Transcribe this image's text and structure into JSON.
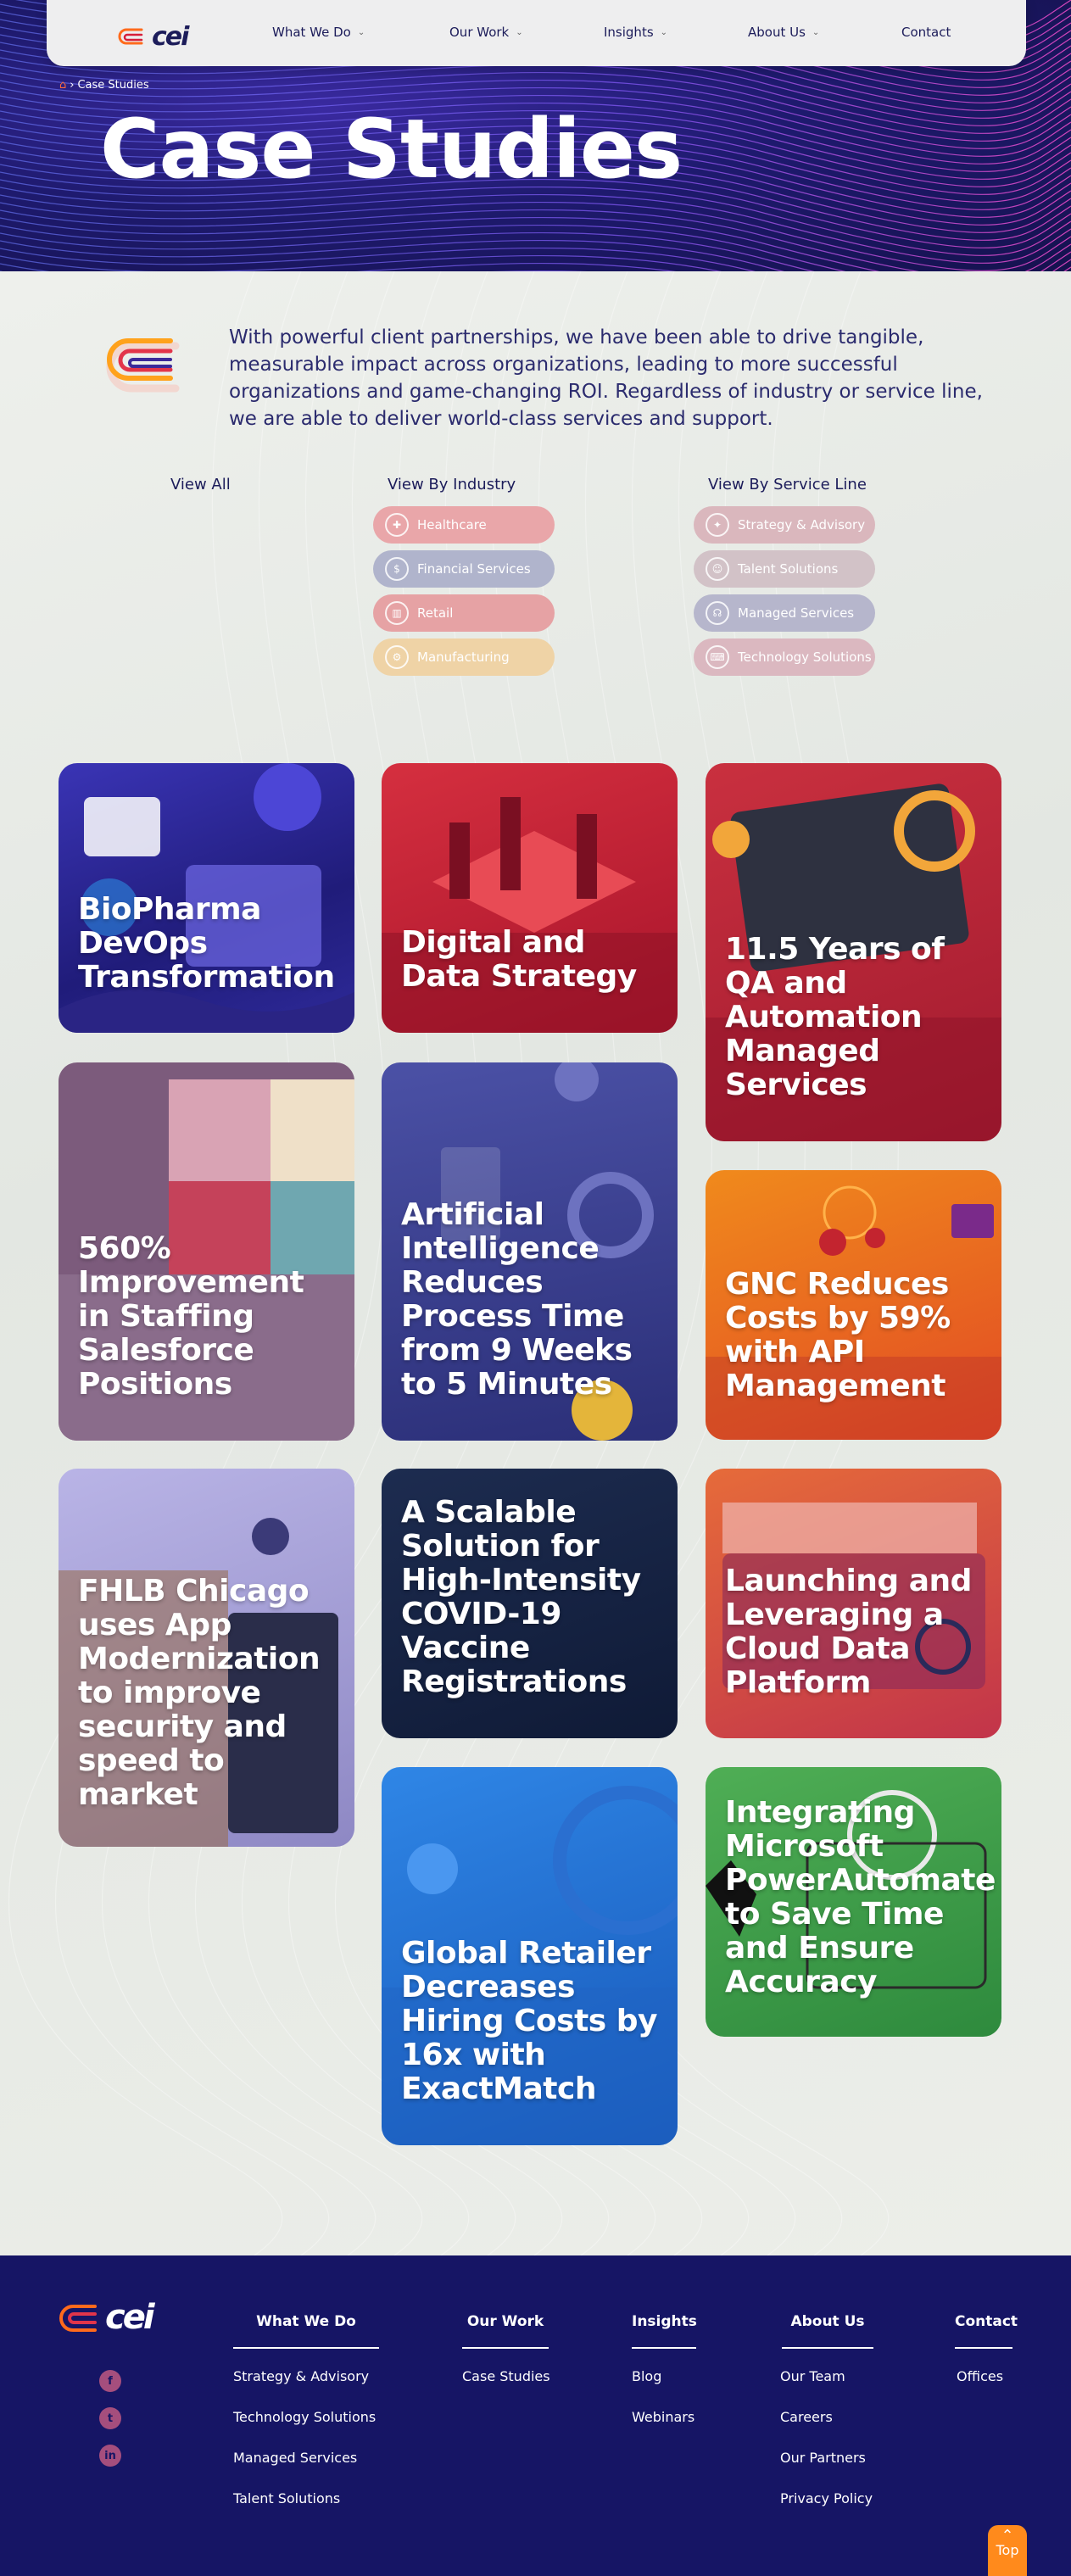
{
  "nav": {
    "logo_text": "cei",
    "items": [
      {
        "label": "What We Do",
        "has_dropdown": true
      },
      {
        "label": "Our Work",
        "has_dropdown": true
      },
      {
        "label": "Insights",
        "has_dropdown": true
      },
      {
        "label": "About Us",
        "has_dropdown": true
      },
      {
        "label": "Contact",
        "has_dropdown": false
      }
    ]
  },
  "hero": {
    "breadcrumb": "Case Studies",
    "title": "Case Studies"
  },
  "intro": {
    "text": "With powerful client partnerships, we have been able to drive tangible, measurable impact across organizations, leading to more successful organizations and game-changing ROI. Regardless of industry or service line, we are able to deliver world-class services and support."
  },
  "filters": {
    "view_all": "View All",
    "industry_heading": "View By Industry",
    "service_heading": "View By Service Line",
    "industries": [
      {
        "label": "Healthcare",
        "icon": "healthcare-icon",
        "color": "#e9a6a9"
      },
      {
        "label": "Financial Services",
        "icon": "gear-dollar-icon",
        "color": "#b0b4cc"
      },
      {
        "label": "Retail",
        "icon": "retail-icon",
        "color": "#e6a2a4"
      },
      {
        "label": "Manufacturing",
        "icon": "manufacturing-icon",
        "color": "#efd3a6"
      }
    ],
    "services": [
      {
        "label": "Strategy & Advisory",
        "icon": "strategy-icon",
        "color": "#dab7bd"
      },
      {
        "label": "Talent Solutions",
        "icon": "talent-icon",
        "color": "#d2c2c7"
      },
      {
        "label": "Managed Services",
        "icon": "managed-services-icon",
        "color": "#b6b6cc"
      },
      {
        "label": "Technology Solutions",
        "icon": "technology-icon",
        "color": "#dbb8c0"
      }
    ]
  },
  "cards": [
    {
      "title": "BioPharma DevOps Transformation",
      "color": "#2c2a8a"
    },
    {
      "title": "Digital and Data Strategy",
      "color": "#b81d33"
    },
    {
      "title": "11.5 Years of QA and Automation Managed Services",
      "color": "#b5243a"
    },
    {
      "title": "560% Improvement in Staffing Salesforce Positions",
      "color": "#7c5b7c"
    },
    {
      "title": "Artificial Intelligence Reduces Process Time from 9 Weeks to 5 Minutes",
      "color": "#3c4290"
    },
    {
      "title": "GNC Reduces Costs by 59% with API Management",
      "color": "#e8621e"
    },
    {
      "title": "FHLB Chicago uses App Modernization to improve security and speed to market",
      "color": "#8e88c4"
    },
    {
      "title": "A Scalable Solution for High-Intensity COVID-19 Vaccine Registrations",
      "color": "#132043"
    },
    {
      "title": "Launching and Leveraging a Cloud Data Platform",
      "color": "#c2344a"
    },
    {
      "title": "Global Retailer Decreases Hiring Costs by 16x with ExactMatch",
      "color": "#1a6bd1"
    },
    {
      "title": "Integrating Microsoft PowerAutomate to Save Time and Ensure Accuracy",
      "color": "#3e9a46"
    }
  ],
  "footer": {
    "logo_text": "cei",
    "social": [
      {
        "icon": "facebook-icon",
        "glyph": "f"
      },
      {
        "icon": "twitter-icon",
        "glyph": "t"
      },
      {
        "icon": "linkedin-icon",
        "glyph": "in"
      }
    ],
    "columns": [
      {
        "heading": "What We Do",
        "links": [
          "Strategy & Advisory",
          "Technology Solutions",
          "Managed Services",
          "Talent Solutions"
        ]
      },
      {
        "heading": "Our Work",
        "links": [
          "Case Studies"
        ]
      },
      {
        "heading": "Insights",
        "links": [
          "Blog",
          "Webinars"
        ]
      },
      {
        "heading": "About Us",
        "links": [
          "Our Team",
          "Careers",
          "Our Partners",
          "Privacy Policy"
        ]
      },
      {
        "heading": "Contact",
        "links": [
          "Offices"
        ]
      }
    ],
    "top_button": "Top"
  }
}
